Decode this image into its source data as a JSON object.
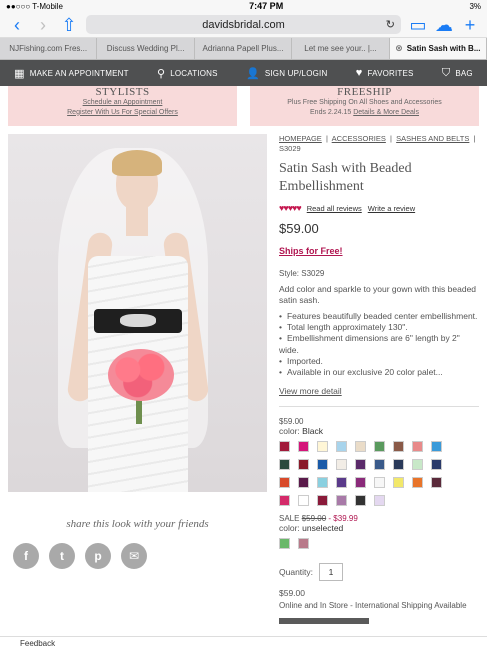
{
  "status_bar": {
    "carrier": "●●○○○ T-Mobile",
    "time": "7:47 PM",
    "battery": "3%"
  },
  "browser": {
    "url": "davidsbridal.com",
    "back_icon": "chevron-left",
    "forward_icon": "chevron-right"
  },
  "tabs": [
    {
      "label": "NJFishing.com Fres..."
    },
    {
      "label": "Discuss Wedding Pl..."
    },
    {
      "label": "Adrianna Papell Plus..."
    },
    {
      "label": "Let me see your.. |..."
    },
    {
      "label": "Satin Sash with B..."
    }
  ],
  "site_nav": {
    "appointment": "MAKE AN APPOINTMENT",
    "locations": "LOCATIONS",
    "signup": "SIGN UP/LOGIN",
    "favorites": "FAVORITES",
    "bag": "BAG"
  },
  "promo_left": {
    "title": "STYLISTS",
    "line1": "Schedule an Appointment",
    "line2": "Register With Us For Special Offers"
  },
  "promo_right": {
    "title": "FREESHIP",
    "line1": "Plus Free Shipping On All Shoes and Accessories",
    "line2_prefix": "Ends 2.24.15",
    "line2_link": "Details & More Deals"
  },
  "breadcrumb": {
    "home": "HOMEPAGE",
    "accessories": "ACCESSORIES",
    "sashes": "SASHES AND BELTS",
    "sku": "S3029"
  },
  "product": {
    "title": "Satin Sash with Beaded Embellishment",
    "stars": "♥♥♥♥♥",
    "read_reviews": "Read all reviews",
    "write_review": "Write a review",
    "price": "$59.00",
    "ships": "Ships for Free!",
    "style": "Style: S3029",
    "description": "Add color and sparkle to your gown with this beaded satin sash.",
    "bullets": [
      "Features beautifully beaded center embellishment.",
      "Total length approximately 130\".",
      "Embellishment dimensions are 6\" length by 2\" wide.",
      "Imported.",
      "Available in our exclusive 20 color palet..."
    ],
    "view_more": "View more detail",
    "price_small": "$59.00",
    "color_label": "color:",
    "color_value": "Black",
    "swatch_colors": [
      "#a11a3a",
      "#d4157a",
      "#fff6d6",
      "#a8d4ec",
      "#eadcc8",
      "#5a9a5e",
      "#8a5a48",
      "#e88a8a",
      "#3a9ad9",
      "#2a4a3e",
      "#8a1a2a",
      "#1a5aa8",
      "#f2ede6",
      "#5a2a6a",
      "#3a5a8a",
      "#2a3a5a",
      "#c8e8c8",
      "#2a3a6a",
      "#d84a2a",
      "#5a1a4a",
      "#8ad0e0",
      "#5a3a8a",
      "#8a2a7a",
      "#f7f7f7",
      "#f2e86a",
      "#e8742a",
      "#5a2a3a",
      "#d42a6a",
      "#ffffff",
      "#8a1a3a",
      "#a87aa8",
      "#333333",
      "#e4d8f0"
    ],
    "sale_label": "SALE",
    "sale_old": "$59.00",
    "sale_new": "- $39.99",
    "sale_color_label": "color:",
    "sale_color_value": "unselected",
    "sale_swatch_colors": [
      "#6ab86a",
      "#b87a8a"
    ],
    "qty_label": "Quantity:",
    "qty_value": "1",
    "price_bottom": "$59.00",
    "availability": "Online and In Store - International Shipping Available"
  },
  "share": {
    "text": "share this look with your friends",
    "icons": [
      "f",
      "t",
      "p",
      "✉"
    ]
  },
  "feedback": "Feedback"
}
